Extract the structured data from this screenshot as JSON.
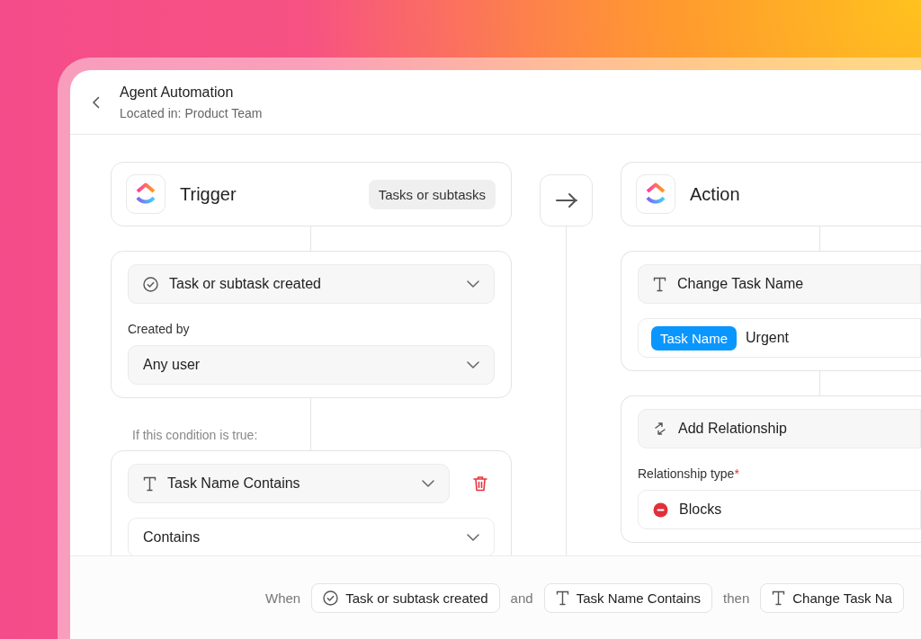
{
  "header": {
    "title": "Agent Automation",
    "subtitle": "Located in: Product Team"
  },
  "trigger": {
    "title": "Trigger",
    "badge": "Tasks or subtasks",
    "event": {
      "label": "Task or subtask created"
    },
    "created_by_label": "Created by",
    "created_by": {
      "value": "Any user"
    },
    "condition_label": "If this condition is true:",
    "condition": {
      "field": {
        "label": "Task Name Contains"
      },
      "operator": {
        "value": "Contains"
      }
    }
  },
  "action": {
    "title": "Action",
    "change": {
      "label": "Change Task Name",
      "tag": "Task Name",
      "value": "Urgent"
    },
    "relationship": {
      "label": "Add Relationship",
      "field_label": "Relationship type",
      "required_mark": "*",
      "value": "Blocks"
    }
  },
  "summary": [
    {
      "kind": "word",
      "text": "When"
    },
    {
      "kind": "event",
      "text": "Task or subtask created"
    },
    {
      "kind": "word",
      "text": "and"
    },
    {
      "kind": "text-field",
      "text": "Task Name Contains"
    },
    {
      "kind": "word",
      "text": "then"
    },
    {
      "kind": "text-field",
      "text": "Change Task Na"
    }
  ]
}
